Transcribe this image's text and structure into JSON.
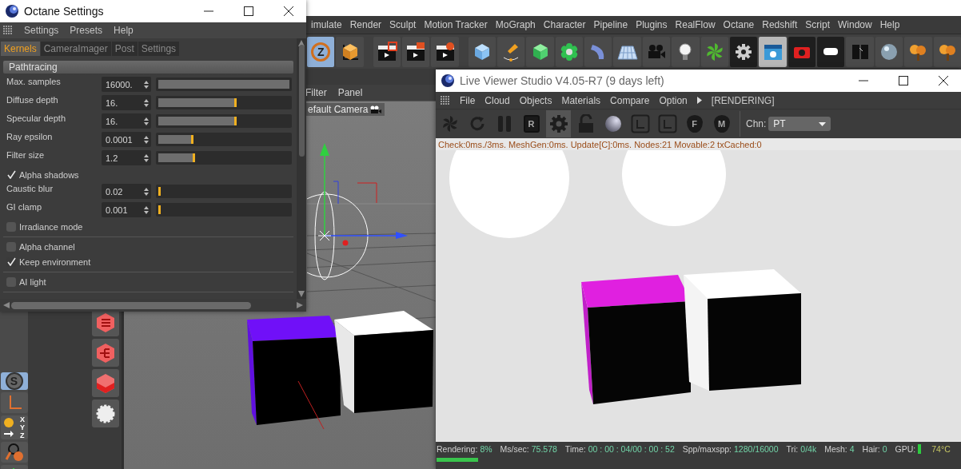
{
  "app": {
    "menu": [
      "imulate",
      "Render",
      "Sculpt",
      "Motion Tracker",
      "MoGraph",
      "Character",
      "Pipeline",
      "Plugins",
      "RealFlow",
      "Octane",
      "Redshift",
      "Script",
      "Window",
      "Help"
    ],
    "axis_label": "Z",
    "snap_label": "S",
    "coordinate_labels": [
      "X",
      "Y",
      "Z"
    ],
    "viewport": {
      "menu": [
        "Filter",
        "Panel"
      ],
      "camera": "efault Camera"
    }
  },
  "octane_settings": {
    "title": "Octane Settings",
    "menu": [
      "Settings",
      "Presets",
      "Help"
    ],
    "tabs": [
      {
        "label": "Kernels",
        "selected": true
      },
      {
        "label": "CameraImager",
        "selected": false
      },
      {
        "label": "Post",
        "selected": false
      },
      {
        "label": "Settings",
        "selected": false
      }
    ],
    "section": "Pathtracing",
    "groups": [
      [
        {
          "kind": "slider",
          "label": "Max. samples",
          "value": "16000.",
          "level": 1
        },
        {
          "kind": "slider",
          "label": "Diffuse depth",
          "value": "16.",
          "level": 0.6
        },
        {
          "kind": "slider",
          "label": "Specular depth",
          "value": "16.",
          "level": 0.6
        },
        {
          "kind": "slider",
          "label": "Ray epsilon",
          "value": "0.0001",
          "level": 0.27
        },
        {
          "kind": "slider",
          "label": "Filter size",
          "value": "1.2",
          "level": 0.28
        },
        {
          "kind": "checkbox",
          "label": "Alpha shadows",
          "checked": true
        },
        {
          "kind": "slider",
          "label": "Caustic blur",
          "value": "0.02",
          "level": 0.01
        },
        {
          "kind": "slider",
          "label": "GI clamp",
          "value": "0.001",
          "level": 0
        },
        {
          "kind": "checkbox",
          "label": "Irradiance mode",
          "checked": false
        }
      ],
      [
        {
          "kind": "checkbox",
          "label": "Alpha channel",
          "checked": false
        },
        {
          "kind": "checkbox",
          "label": "Keep environment",
          "checked": true
        }
      ],
      [
        {
          "kind": "checkbox",
          "label": "AI light",
          "checked": false
        }
      ]
    ]
  },
  "live_viewer": {
    "title": "Live Viewer Studio V4.05-R7 (9 days left)",
    "menu": [
      "File",
      "Cloud",
      "Objects",
      "Materials",
      "Compare",
      "Option"
    ],
    "status": "[RENDERING]",
    "toolbar": [
      {
        "kind": "octane",
        "active": false
      },
      {
        "kind": "refresh",
        "active": false
      },
      {
        "kind": "pause",
        "active": false
      },
      {
        "kind": "letter",
        "text": "R",
        "active": false
      },
      {
        "kind": "gear",
        "active": true
      },
      {
        "kind": "lock",
        "active": false
      },
      {
        "kind": "sphere",
        "active": false
      },
      {
        "kind": "frame",
        "active": false
      },
      {
        "kind": "frame",
        "active": false
      },
      {
        "kind": "pin",
        "text": "F",
        "active": false
      },
      {
        "kind": "pin",
        "text": "M",
        "active": false
      }
    ],
    "channel": {
      "label": "Chn:",
      "value": "PT"
    },
    "info": "Check:0ms./3ms. MeshGen:0ms. Update[C]:0ms. Nodes:21 Movable:2 txCached:0",
    "stats": [
      {
        "kind": "stat",
        "label": "Rendering:",
        "value": "8%"
      },
      {
        "kind": "stat",
        "label": "Ms/sec:",
        "value": "75.578"
      },
      {
        "kind": "stat",
        "label": "Time:",
        "value": "00 : 00 : 04/00 : 00 : 52"
      },
      {
        "kind": "stat",
        "label": "Spp/maxspp:",
        "value": "1280/16000"
      },
      {
        "kind": "stat",
        "label": "Tri:",
        "value": "0/4k"
      },
      {
        "kind": "stat",
        "label": "Mesh:",
        "value": "4"
      },
      {
        "kind": "stat",
        "label": "Hair:",
        "value": "0"
      },
      {
        "kind": "gpu",
        "label": "GPU:",
        "value": "74°C"
      }
    ],
    "progress": {
      "level": 0.08
    }
  }
}
